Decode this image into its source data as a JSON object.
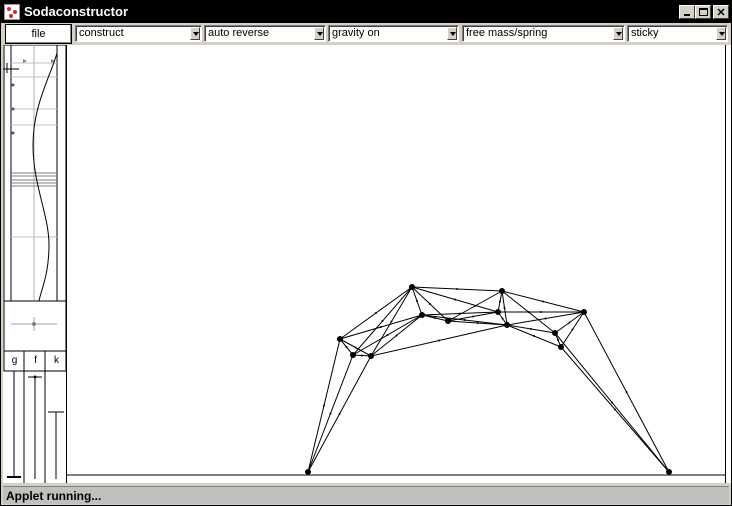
{
  "window": {
    "title": "Sodaconstructor"
  },
  "toolbar": {
    "file_label": "file",
    "dropdowns": [
      {
        "name": "mode-select",
        "value": "construct"
      },
      {
        "name": "reverse-select",
        "value": "auto reverse"
      },
      {
        "name": "gravity-select",
        "value": "gravity on"
      },
      {
        "name": "mass-spring-select",
        "value": "free mass/spring"
      },
      {
        "name": "surface-select",
        "value": "sticky"
      }
    ]
  },
  "left_panel": {
    "slider_labels": [
      "g",
      "f",
      "k"
    ]
  },
  "status": {
    "text": "Applet running..."
  },
  "icons": {
    "app": "sodaconstructor-app-icon",
    "minimize": "minimize-icon",
    "maximize": "maximize-icon",
    "close": "close-icon",
    "dropdown_arrow": "chevron-down-icon"
  }
}
